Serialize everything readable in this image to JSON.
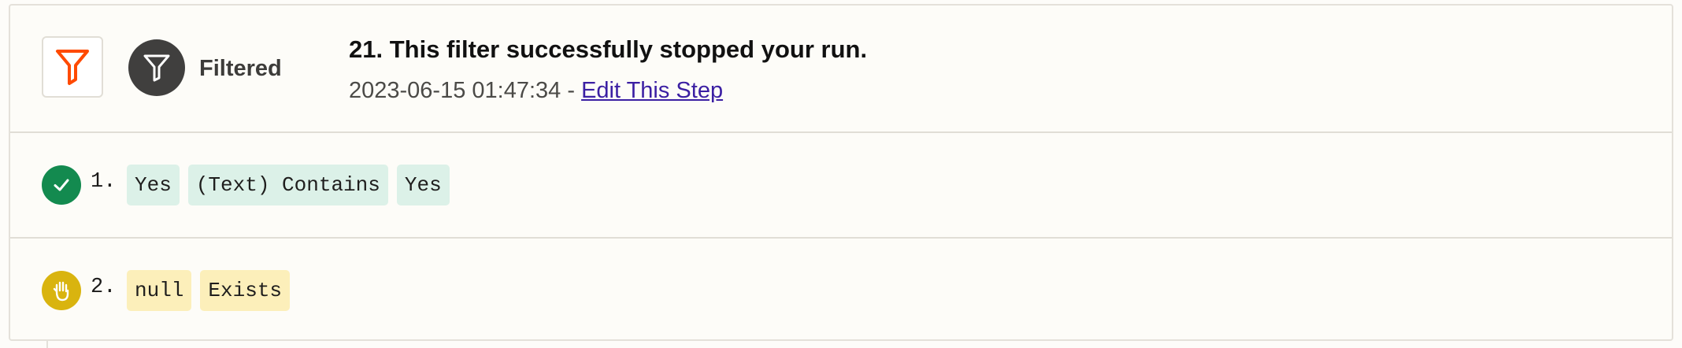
{
  "header": {
    "app_icon": "filter-funnel-icon",
    "status_icon": "filter-funnel-icon",
    "status_label": "Filtered",
    "title": "21. This filter successfully stopped your run.",
    "timestamp": "2023-06-15 01:47:34",
    "separator": " - ",
    "edit_link": "Edit This Step"
  },
  "conditions": [
    {
      "number": "1.",
      "status_icon": "check-icon",
      "status": "passed",
      "status_color": "#138a4f",
      "chip_color": "#dcf1e8",
      "chips": [
        "Yes",
        "(Text) Contains",
        "Yes"
      ]
    },
    {
      "number": "2.",
      "status_icon": "stop-hand-icon",
      "status": "stopped",
      "status_color": "#d9b40f",
      "chip_color": "#fcefba",
      "chips": [
        "null",
        "Exists"
      ]
    }
  ],
  "colors": {
    "brand_orange": "#ff4a00",
    "link": "#3b1fa3"
  }
}
